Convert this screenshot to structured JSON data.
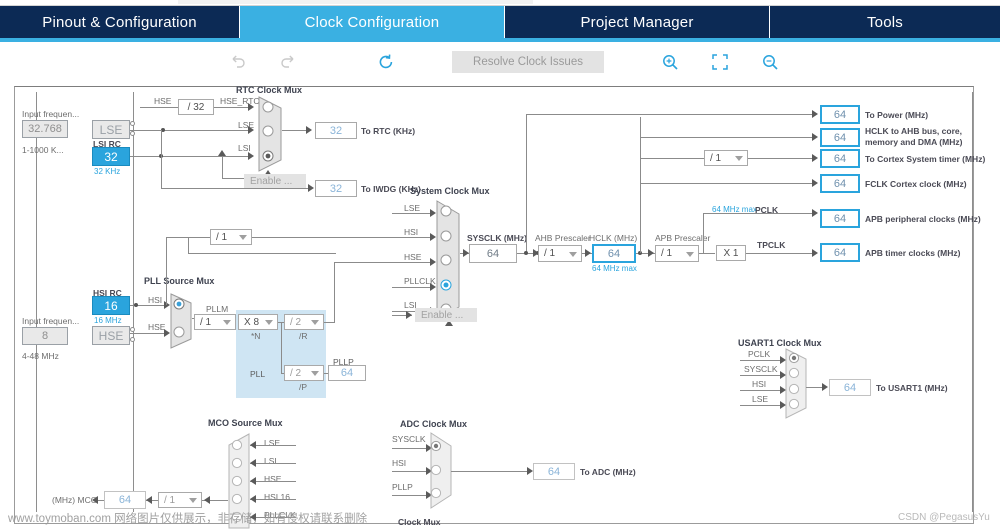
{
  "app": {
    "tabs": [
      {
        "label": "Pinout & Configuration",
        "active": false
      },
      {
        "label": "Clock Configuration",
        "active": true
      },
      {
        "label": "Project Manager",
        "active": false
      },
      {
        "label": "Tools",
        "active": false
      }
    ]
  },
  "toolbar": {
    "undo": "undo-icon",
    "redo": "redo-icon",
    "refresh": "refresh-icon",
    "resolve_label": "Resolve Clock Issues",
    "zoom_in": "zoom-in-icon",
    "fit": "fit-to-screen-icon",
    "zoom_out": "zoom-out-icon"
  },
  "lse": {
    "input_freq_label": "Input frequen...",
    "input_freq_value": "32.768",
    "range": "1-1000 K...",
    "osc_label": "LSE"
  },
  "lsi": {
    "title": "LSI RC",
    "value": "32",
    "unit": "32 KHz"
  },
  "hse": {
    "input_freq_label": "Input frequen...",
    "input_freq_value": "8",
    "range": "4-48 MHz",
    "osc_label": "HSE"
  },
  "hsi": {
    "title": "HSI RC",
    "value": "16",
    "unit": "16 MHz"
  },
  "rtc_mux": {
    "title": "RTC Clock Mux",
    "hse_label": "HSE",
    "hse_div": "/ 32",
    "inputs": [
      "HSE_RTC",
      "LSE",
      "LSI"
    ],
    "selected": 2,
    "enable_label": "Enable ...",
    "rtc_value": "32",
    "rtc_label": "To RTC (KHz)",
    "iwdg_value": "32",
    "iwdg_label": "To IWDG (KHz)"
  },
  "pll_source_mux": {
    "title": "PLL Source Mux",
    "inputs": [
      "HSI",
      "HSE"
    ],
    "selected": 0
  },
  "pll": {
    "pllm_label": "PLLM",
    "pllm_value": "/ 1",
    "n_label": "*N",
    "n_value": "X 8",
    "r_label": "/R",
    "r_value": "/ 2",
    "p_label": "/P",
    "p_value": "/ 2",
    "block_label": "PLL",
    "pllp_label": "PLLP",
    "pllp_value": "64"
  },
  "prescaler_top": {
    "value": "/ 1"
  },
  "system_clock_mux": {
    "title": "System Clock Mux",
    "inputs": [
      "LSE",
      "HSI",
      "HSE",
      "PLLCLK",
      "LSI"
    ],
    "selected": 3,
    "enable_label": "Enable ..."
  },
  "sysclk": {
    "label": "SYSCLK (MHz)",
    "value": "64"
  },
  "ahb": {
    "label": "AHB Prescaler",
    "value": "/ 1"
  },
  "hclk": {
    "label": "HCLK (MHz)",
    "value": "64",
    "max": "64 MHz max"
  },
  "apb": {
    "label": "APB Prescaler",
    "value": "/ 1",
    "pclk_max": "64 MHz max",
    "pclk_label": "PCLK",
    "tpclk_multiplier": "X 1",
    "tpclk_label": "TPCLK",
    "peripheral_value": "64",
    "peripheral_label": "APB peripheral clocks (MHz)",
    "timer_value": "64",
    "timer_label": "APB timer clocks (MHz)"
  },
  "outputs": [
    {
      "value": "64",
      "label": "To Power (MHz)"
    },
    {
      "value": "64",
      "label": "HCLK to AHB bus, core,",
      "label2": "memory and DMA (MHz)"
    },
    {
      "value": "64",
      "label": "To Cortex System timer (MHz)",
      "prescaler": "/ 1"
    },
    {
      "value": "64",
      "label": "FCLK Cortex clock (MHz)"
    }
  ],
  "usart1_mux": {
    "title": "USART1 Clock Mux",
    "inputs": [
      "PCLK",
      "SYSCLK",
      "HSI",
      "LSE"
    ],
    "selected": 0,
    "value": "64",
    "label": "To USART1 (MHz)"
  },
  "mco_mux": {
    "title": "MCO Source Mux",
    "inputs": [
      "LSE",
      "LSI",
      "HSE",
      "HSI 16",
      "PLLCLK"
    ],
    "selected": -1,
    "prescaler": "/ 1",
    "value": "64",
    "label": "(MHz) MCO"
  },
  "adc_mux": {
    "title": "ADC Clock Mux",
    "inputs": [
      "SYSCLK",
      "HSI",
      "PLLP"
    ],
    "selected": 0,
    "value": "64",
    "label": "To ADC (MHz)",
    "footer": "Clock Mux"
  },
  "watermark": {
    "left": "www.toymoban.com 网络图片仅供展示，非存储，如有侵权请联系删除",
    "right": "CSDN @PegasusYu"
  }
}
